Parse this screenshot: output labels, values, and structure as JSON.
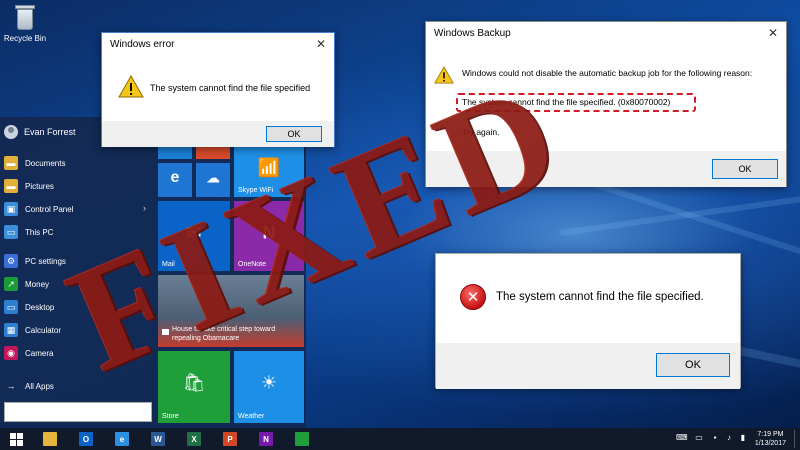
{
  "desktop": {
    "recycle_bin_label": "Recycle Bin"
  },
  "start_menu": {
    "user_name": "Evan Forrest",
    "items": [
      {
        "label": "Documents",
        "icon": "folder-icon",
        "color": "#e0b03a"
      },
      {
        "label": "Pictures",
        "icon": "folder-icon",
        "color": "#e0b03a"
      },
      {
        "label": "Control Panel",
        "icon": "control-panel-icon",
        "color": "#3a8fd8"
      },
      {
        "label": "This PC",
        "icon": "computer-icon",
        "color": "#3a8fd8"
      },
      {
        "label": "PC settings",
        "icon": "gear-icon",
        "color": "#3a6fd8"
      },
      {
        "label": "Money",
        "icon": "chart-icon",
        "color": "#1a9b3a"
      },
      {
        "label": "Desktop",
        "icon": "desktop-icon",
        "color": "#2f7fd1"
      },
      {
        "label": "Calculator",
        "icon": "calculator-icon",
        "color": "#2f7fd1"
      },
      {
        "label": "Camera",
        "icon": "camera-icon",
        "color": "#c2185b"
      }
    ],
    "all_apps_label": "All Apps",
    "tiles": {
      "skype_wifi": "Skype WiFi",
      "mail": "Mail",
      "onenote": "OneNote",
      "news_headline": "House to take critical step toward repealing Obamacare",
      "store": "Store",
      "weather": "Weather"
    }
  },
  "windows_error": {
    "title": "Windows error",
    "message": "The system cannot find the file specified",
    "ok_label": "OK",
    "close_glyph": "✕"
  },
  "windows_backup": {
    "title": "Windows Backup",
    "message": "Windows could not disable the automatic backup job for the following reason:",
    "error_detail": "The system cannot find the file specified. (0x80070002)",
    "try_again": "Try again.",
    "ok_label": "OK",
    "close_glyph": "✕"
  },
  "system_error": {
    "message": "The system cannot find the file specified.",
    "ok_label": "OK"
  },
  "stamp": {
    "text": "FIXED"
  },
  "taskbar": {
    "apps": [
      {
        "icon": "file-explorer-icon",
        "color": "#e6b43c",
        "glyph": ""
      },
      {
        "icon": "outlook-icon",
        "color": "#0a64c8",
        "glyph": "O"
      },
      {
        "icon": "edge-icon",
        "color": "#2d8fe0",
        "glyph": "e"
      },
      {
        "icon": "word-icon",
        "color": "#2b5797",
        "glyph": "W"
      },
      {
        "icon": "excel-icon",
        "color": "#1e7145",
        "glyph": "X"
      },
      {
        "icon": "powerpoint-icon",
        "color": "#d24726",
        "glyph": "P"
      },
      {
        "icon": "onenote-icon",
        "color": "#7719aa",
        "glyph": "N"
      },
      {
        "icon": "store-icon",
        "color": "#1e9f3a",
        "glyph": ""
      }
    ],
    "time": "7:19 PM",
    "date": "1/13/2017"
  },
  "colors": {
    "accent": "#0078d7",
    "stamp_red": "#8c1a14",
    "highlight_red": "#d01b24",
    "warning_yellow": "#f5c518"
  }
}
